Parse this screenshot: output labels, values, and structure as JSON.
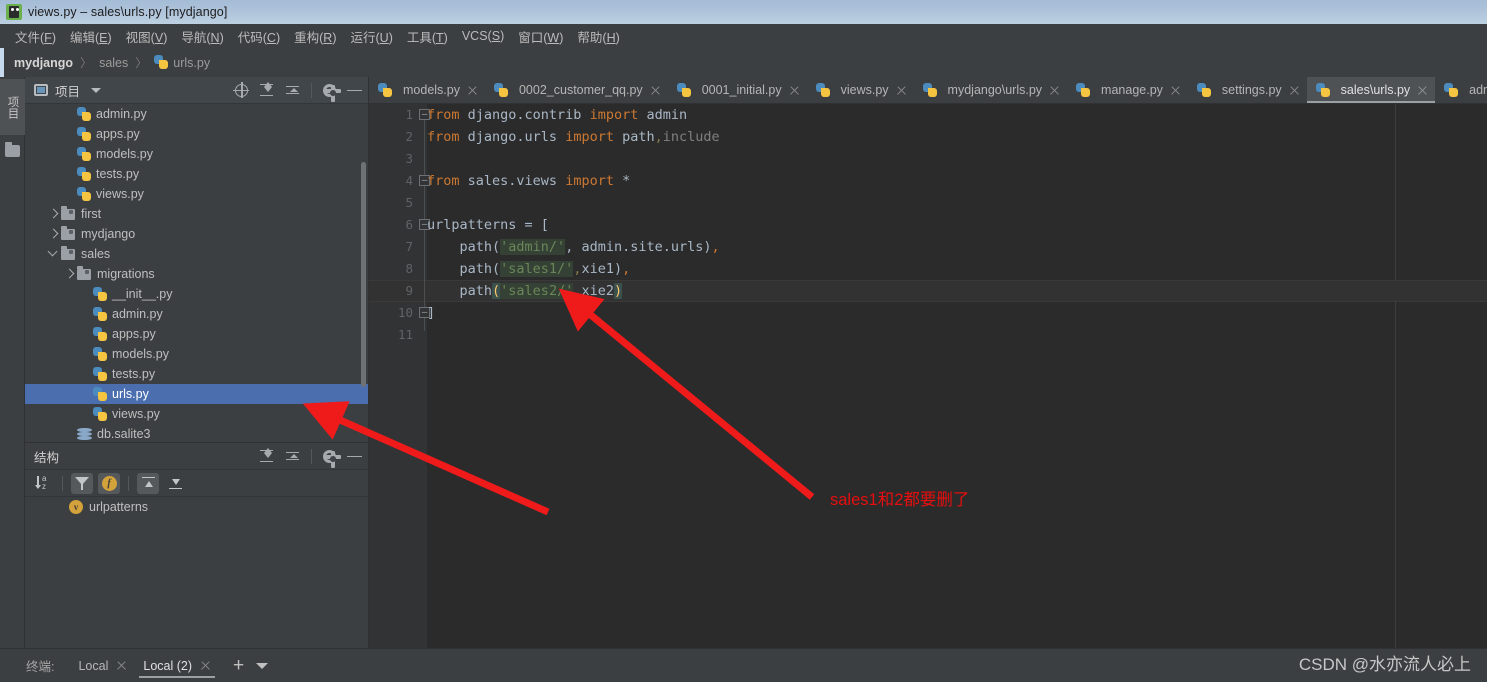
{
  "window": {
    "title": "views.py – sales\\urls.py [mydjango]",
    "icon": "pycharm-icon"
  },
  "menubar": [
    {
      "label": "文件(F)",
      "mnemonic": "F"
    },
    {
      "label": "编辑(E)",
      "mnemonic": "E"
    },
    {
      "label": "视图(V)",
      "mnemonic": "V"
    },
    {
      "label": "导航(N)",
      "mnemonic": "N"
    },
    {
      "label": "代码(C)",
      "mnemonic": "C"
    },
    {
      "label": "重构(R)",
      "mnemonic": "R"
    },
    {
      "label": "运行(U)",
      "mnemonic": "U"
    },
    {
      "label": "工具(T)",
      "mnemonic": "T"
    },
    {
      "label": "VCS(S)",
      "mnemonic": "S"
    },
    {
      "label": "窗口(W)",
      "mnemonic": "W"
    },
    {
      "label": "帮助(H)",
      "mnemonic": "H"
    }
  ],
  "breadcrumb": {
    "items": [
      "mydjango",
      "sales",
      "urls.py"
    ],
    "separator": "〉"
  },
  "left_strip": {
    "tab_label": "项目",
    "folder_icon": "folder-icon"
  },
  "project_panel": {
    "title": "项目",
    "icons": [
      "locate-target-icon",
      "expand-all-icon",
      "collapse-all-icon",
      "gear-icon",
      "minimize-icon"
    ],
    "tree": [
      {
        "label": "admin.py",
        "indent": 3,
        "icon": "python-file-icon",
        "twisty": "none",
        "selected": false
      },
      {
        "label": "apps.py",
        "indent": 3,
        "icon": "python-file-icon",
        "twisty": "none",
        "selected": false
      },
      {
        "label": "models.py",
        "indent": 3,
        "icon": "python-file-icon",
        "twisty": "none",
        "selected": false
      },
      {
        "label": "tests.py",
        "indent": 3,
        "icon": "python-file-icon",
        "twisty": "none",
        "selected": false
      },
      {
        "label": "views.py",
        "indent": 3,
        "icon": "python-file-icon",
        "twisty": "none",
        "selected": false
      },
      {
        "label": "first",
        "indent": 2,
        "icon": "folder-icon",
        "twisty": "collapsed",
        "selected": false
      },
      {
        "label": "mydjango",
        "indent": 2,
        "icon": "folder-icon",
        "twisty": "collapsed",
        "selected": false
      },
      {
        "label": "sales",
        "indent": 2,
        "icon": "folder-icon",
        "twisty": "expanded",
        "selected": false
      },
      {
        "label": "migrations",
        "indent": 3,
        "icon": "folder-icon",
        "twisty": "collapsed",
        "selected": false
      },
      {
        "label": "__init__.py",
        "indent": 4,
        "icon": "python-file-icon",
        "twisty": "none",
        "selected": false
      },
      {
        "label": "admin.py",
        "indent": 4,
        "icon": "python-file-icon",
        "twisty": "none",
        "selected": false
      },
      {
        "label": "apps.py",
        "indent": 4,
        "icon": "python-file-icon",
        "twisty": "none",
        "selected": false
      },
      {
        "label": "models.py",
        "indent": 4,
        "icon": "python-file-icon",
        "twisty": "none",
        "selected": false
      },
      {
        "label": "tests.py",
        "indent": 4,
        "icon": "python-file-icon",
        "twisty": "none",
        "selected": false
      },
      {
        "label": "urls.py",
        "indent": 4,
        "icon": "python-file-icon",
        "twisty": "none",
        "selected": true
      },
      {
        "label": "views.py",
        "indent": 4,
        "icon": "python-file-icon",
        "twisty": "none",
        "selected": false
      },
      {
        "label": "db.salite3",
        "indent": 3,
        "icon": "database-icon",
        "twisty": "none",
        "selected": false
      }
    ]
  },
  "structure_panel": {
    "title": "结构",
    "header_icons": [
      "expand-all-icon",
      "collapse-all-icon",
      "gear-icon",
      "minimize-icon"
    ],
    "toolbar_icons": [
      {
        "name": "sort-alphabetically-icon",
        "active": false
      },
      {
        "name": "filter-funnel-icon",
        "active": true
      },
      {
        "name": "show-fields-icon",
        "active": true
      },
      {
        "name": "show-inherited-icon",
        "active": true
      },
      {
        "name": "show-imported-icon",
        "active": false
      }
    ],
    "items": [
      {
        "label": "urlpatterns",
        "badge": "v"
      }
    ]
  },
  "editor_tabs": [
    {
      "label": "models.py",
      "active": false
    },
    {
      "label": "0002_customer_qq.py",
      "active": false
    },
    {
      "label": "0001_initial.py",
      "active": false
    },
    {
      "label": "views.py",
      "active": false
    },
    {
      "label": "mydjango\\urls.py",
      "active": false
    },
    {
      "label": "manage.py",
      "active": false
    },
    {
      "label": "settings.py",
      "active": false
    },
    {
      "label": "sales\\urls.py",
      "active": true
    },
    {
      "label": "admin.py",
      "active": false
    }
  ],
  "editor": {
    "current_line": 9,
    "line_numbers": [
      "1",
      "2",
      "3",
      "4",
      "5",
      "6",
      "7",
      "8",
      "9",
      "10",
      "11"
    ],
    "lines": [
      {
        "n": 1,
        "text": "from django.contrib import admin",
        "fold": "start"
      },
      {
        "n": 2,
        "text": "from django.urls import path,include",
        "fold": "none"
      },
      {
        "n": 3,
        "text": "",
        "fold": "none"
      },
      {
        "n": 4,
        "text": "from sales.views import *",
        "fold": "single"
      },
      {
        "n": 5,
        "text": "",
        "fold": "none"
      },
      {
        "n": 6,
        "text": "urlpatterns = [",
        "fold": "start"
      },
      {
        "n": 7,
        "text": "    path('admin/', admin.site.urls),",
        "fold": "none"
      },
      {
        "n": 8,
        "text": "    path('sales1/',xie1),",
        "fold": "none"
      },
      {
        "n": 9,
        "text": "    path('sales2/',xie2)",
        "fold": "none"
      },
      {
        "n": 10,
        "text": "]",
        "fold": "end"
      },
      {
        "n": 11,
        "text": "",
        "fold": "none"
      }
    ]
  },
  "annotations": [
    {
      "name": "delete-note",
      "text": "sales1和2都要删了",
      "color": "#e60e0e"
    }
  ],
  "bottom_bar": {
    "label": "终端:",
    "tabs": [
      {
        "label": "Local",
        "active": false
      },
      {
        "label": "Local (2)",
        "active": true
      }
    ],
    "add_label": "+",
    "dropdown_icon": "chevron-down-icon"
  },
  "watermark": {
    "text": "CSDN @水亦流人必上"
  },
  "colors": {
    "titlebar": "#aec3da",
    "chrome": "#3c3f41",
    "editor_bg": "#2b2b2b",
    "gutter_bg": "#313335",
    "selection": "#4b6eaf",
    "keyword": "#cc7832",
    "string": "#6a8759",
    "identifier": "#a9b7c6",
    "annotation_red": "#e60e0e"
  }
}
